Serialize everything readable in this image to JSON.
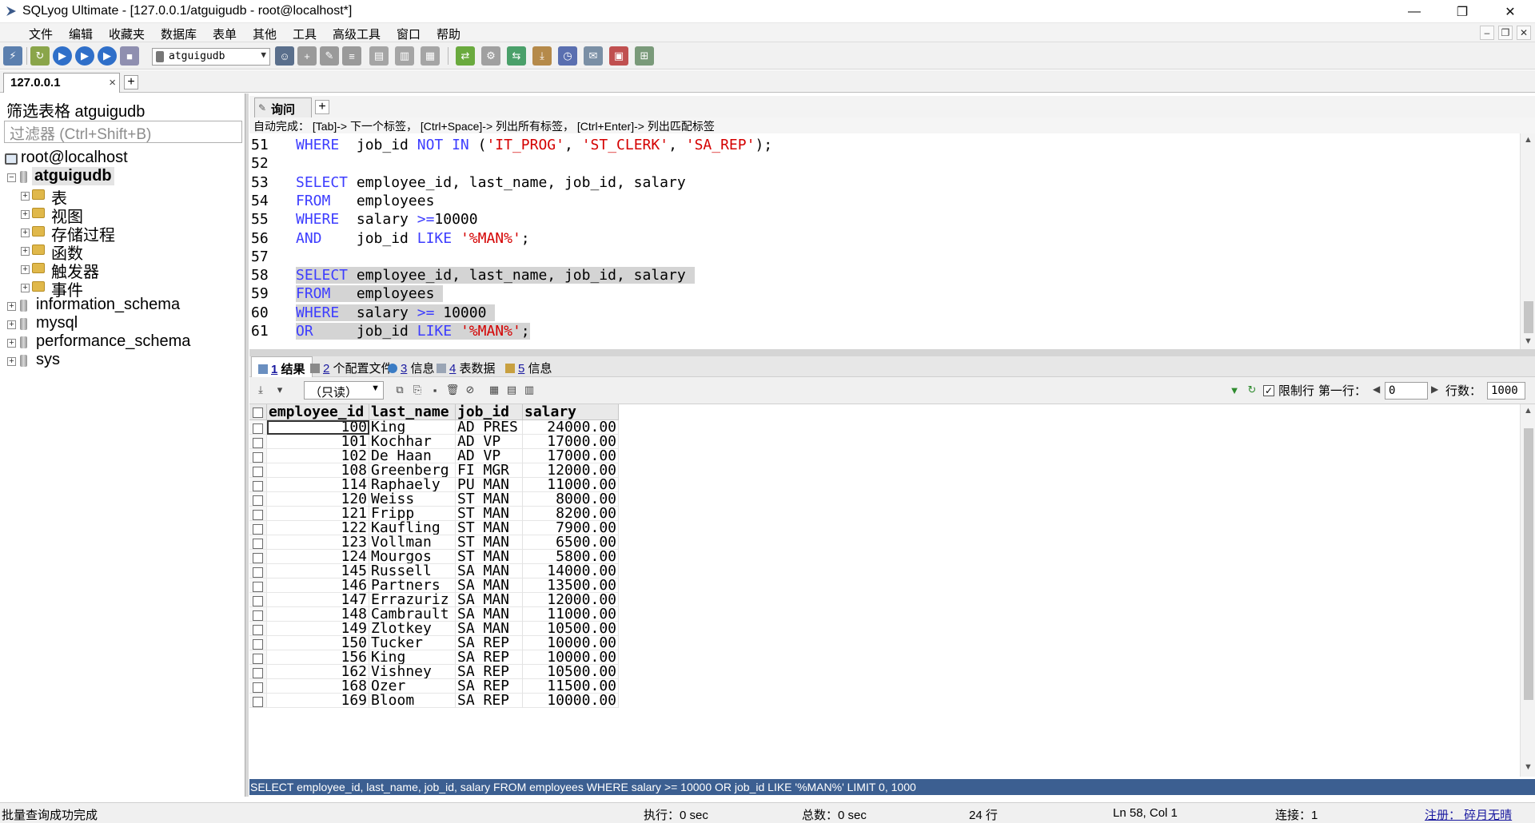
{
  "window": {
    "title": "SQLyog Ultimate - [127.0.0.1/atguigudb - root@localhost*]",
    "minimize": "—",
    "restore": "❐",
    "close": "✕"
  },
  "menu": [
    "文件",
    "编辑",
    "收藏夹",
    "数据库",
    "表单",
    "其他",
    "工具",
    "高级工具",
    "窗口",
    "帮助"
  ],
  "mdi_controls": [
    "–",
    "❐",
    "✕"
  ],
  "toolbar": {
    "database_select": "atguigudb"
  },
  "connection_tab": {
    "label": "127.0.0.1",
    "close": "×",
    "add": "+"
  },
  "sidebar": {
    "filter_label": "筛选表格 atguigudb",
    "filter_placeholder": "过滤器 (Ctrl+Shift+B)",
    "host": "root@localhost",
    "current_db": "atguigudb",
    "db_children": [
      "表",
      "视图",
      "存储过程",
      "函数",
      "触发器",
      "事件"
    ],
    "other_dbs": [
      "information_schema",
      "mysql",
      "performance_schema",
      "sys"
    ]
  },
  "query_tab": {
    "label": "询问",
    "add": "+"
  },
  "autocomplete_hint": "自动完成：  [Tab]-> 下一个标签，  [Ctrl+Space]-> 列出所有标签，  [Ctrl+Enter]-> 列出匹配标签",
  "editor": {
    "lines": [
      {
        "n": "51",
        "tokens": [
          [
            "kw",
            "WHERE"
          ],
          [
            "t",
            "  job_id "
          ],
          [
            "kw",
            "NOT IN"
          ],
          [
            "t",
            " ("
          ],
          [
            "str",
            "'IT_PROG'"
          ],
          [
            "t",
            ", "
          ],
          [
            "str",
            "'ST_CLERK'"
          ],
          [
            "t",
            ", "
          ],
          [
            "str",
            "'SA_REP'"
          ],
          [
            "t",
            ");"
          ]
        ],
        "sel": false
      },
      {
        "n": "52",
        "tokens": [],
        "sel": false
      },
      {
        "n": "53",
        "tokens": [
          [
            "kw",
            "SELECT"
          ],
          [
            "t",
            " employee_id, last_name, job_id, salary"
          ]
        ],
        "sel": false
      },
      {
        "n": "54",
        "tokens": [
          [
            "kw",
            "FROM"
          ],
          [
            "t",
            "   employees"
          ]
        ],
        "sel": false
      },
      {
        "n": "55",
        "tokens": [
          [
            "kw",
            "WHERE"
          ],
          [
            "t",
            "  salary "
          ],
          [
            "op",
            ">="
          ],
          [
            "t",
            "10000"
          ]
        ],
        "sel": false
      },
      {
        "n": "56",
        "tokens": [
          [
            "kw",
            "AND"
          ],
          [
            "t",
            "    job_id "
          ],
          [
            "kw",
            "LIKE"
          ],
          [
            "t",
            " "
          ],
          [
            "str",
            "'%MAN%'"
          ],
          [
            "t",
            ";"
          ]
        ],
        "sel": false
      },
      {
        "n": "57",
        "tokens": [],
        "sel": false
      },
      {
        "n": "58",
        "tokens": [
          [
            "kw",
            "SELECT"
          ],
          [
            "t",
            " employee_id, last_name, job_id, salary "
          ]
        ],
        "sel": true
      },
      {
        "n": "59",
        "tokens": [
          [
            "kw",
            "FROM"
          ],
          [
            "t",
            "   employees "
          ]
        ],
        "sel": true
      },
      {
        "n": "60",
        "tokens": [
          [
            "kw",
            "WHERE"
          ],
          [
            "t",
            "  salary "
          ],
          [
            "op",
            ">="
          ],
          [
            "t",
            " 10000 "
          ]
        ],
        "sel": true
      },
      {
        "n": "61",
        "tokens": [
          [
            "kw",
            "OR"
          ],
          [
            "t",
            "     job_id "
          ],
          [
            "kw",
            "LIKE"
          ],
          [
            "t",
            " "
          ],
          [
            "str",
            "'%MAN%'"
          ],
          [
            "t",
            ";"
          ]
        ],
        "sel": true
      }
    ]
  },
  "result_tabs": [
    {
      "num": "1",
      "label": "结果",
      "active": true
    },
    {
      "num": "2",
      "label": "个配置文件",
      "active": false
    },
    {
      "num": "3",
      "label": "信息",
      "active": false
    },
    {
      "num": "4",
      "label": "表数据",
      "active": false
    },
    {
      "num": "5",
      "label": "信息",
      "active": false
    }
  ],
  "grid_toolbar": {
    "readonly": "（只读）",
    "limit_label": "限制行",
    "first_row_label": "第一行：",
    "first_row_value": "0",
    "rows_label": "行数：",
    "rows_value": "1000",
    "limit_checked": true
  },
  "grid": {
    "columns": [
      "employee_id",
      "last_name",
      "job_id",
      "salary"
    ],
    "rows": [
      [
        "100",
        "King",
        "AD_PRES",
        "24000.00"
      ],
      [
        "101",
        "Kochhar",
        "AD_VP",
        "17000.00"
      ],
      [
        "102",
        "De Haan",
        "AD_VP",
        "17000.00"
      ],
      [
        "108",
        "Greenberg",
        "FI_MGR",
        "12000.00"
      ],
      [
        "114",
        "Raphaely",
        "PU_MAN",
        "11000.00"
      ],
      [
        "120",
        "Weiss",
        "ST_MAN",
        "8000.00"
      ],
      [
        "121",
        "Fripp",
        "ST_MAN",
        "8200.00"
      ],
      [
        "122",
        "Kaufling",
        "ST_MAN",
        "7900.00"
      ],
      [
        "123",
        "Vollman",
        "ST_MAN",
        "6500.00"
      ],
      [
        "124",
        "Mourgos",
        "ST_MAN",
        "5800.00"
      ],
      [
        "145",
        "Russell",
        "SA_MAN",
        "14000.00"
      ],
      [
        "146",
        "Partners",
        "SA_MAN",
        "13500.00"
      ],
      [
        "147",
        "Errazuriz",
        "SA_MAN",
        "12000.00"
      ],
      [
        "148",
        "Cambrault",
        "SA_MAN",
        "11000.00"
      ],
      [
        "149",
        "Zlotkey",
        "SA_MAN",
        "10500.00"
      ],
      [
        "150",
        "Tucker",
        "SA_REP",
        "10000.00"
      ],
      [
        "156",
        "King",
        "SA_REP",
        "10000.00"
      ],
      [
        "162",
        "Vishney",
        "SA_REP",
        "10500.00"
      ],
      [
        "168",
        "Ozer",
        "SA_REP",
        "11500.00"
      ],
      [
        "169",
        "Bloom",
        "SA_REP",
        "10000.00"
      ]
    ]
  },
  "statement": "SELECT employee_id, last_name, job_id, salary FROM employees WHERE salary >= 10000 OR job_id LIKE '%MAN%' LIMIT 0, 1000",
  "status": {
    "message": "批量查询成功完成",
    "exec": "执行：0 sec",
    "total": "总数：0 sec",
    "rows": "24 行",
    "position": "Ln 58, Col 1",
    "connections": "连接：1",
    "register": "注册：  碎月无晴"
  },
  "colors": {
    "keyword": "#3d3dff",
    "string": "#d40000",
    "statement_bar": "#3c5f91",
    "selection": "#d4d4d4"
  }
}
